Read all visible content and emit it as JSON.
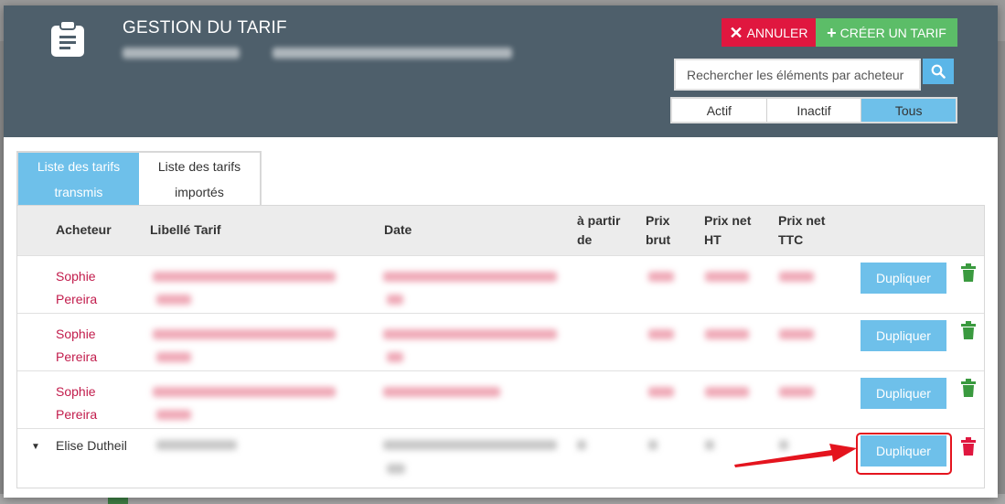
{
  "header": {
    "title": "GESTION DU TARIF",
    "cancel_label": "ANNULER",
    "create_label": "CRÉER UN TARIF",
    "search_placeholder": "Rechercher les éléments par acheteur",
    "filters": [
      {
        "label": "Actif",
        "active": false
      },
      {
        "label": "Inactif",
        "active": false
      },
      {
        "label": "Tous",
        "active": true
      }
    ]
  },
  "tabs": [
    {
      "label_line1": "Liste des tarifs",
      "label_line2": "transmis",
      "active": true
    },
    {
      "label_line1": "Liste des tarifs",
      "label_line2": "importés",
      "active": false
    }
  ],
  "table": {
    "columns": {
      "buyer": "Acheteur",
      "label": "Libellé Tarif",
      "date": "Date",
      "from_line1": "à partir",
      "from_line2": "de",
      "gross_line1": "Prix",
      "gross_line2": "brut",
      "net_ht_line1": "Prix net",
      "net_ht_line2": "HT",
      "net_ttc_line1": "Prix net",
      "net_ttc_line2": "TTC"
    },
    "rows": [
      {
        "buyer_first": "Sophie",
        "buyer_last": "Pereira",
        "action": "Dupliquer",
        "trash_color": "#3a9a3f"
      },
      {
        "buyer_first": "Sophie",
        "buyer_last": "Pereira",
        "action": "Dupliquer",
        "trash_color": "#3a9a3f"
      },
      {
        "buyer_first": "Sophie",
        "buyer_last": "Pereira",
        "action": "Dupliquer",
        "trash_color": "#3a9a3f"
      },
      {
        "buyer_first": "Elise Dutheil",
        "buyer_last": "",
        "action": "Dupliquer",
        "trash_color": "#e0173f"
      }
    ]
  },
  "colors": {
    "header_bg": "#4e5f6b",
    "accent_blue": "#6ec0ea",
    "cancel_red": "#e0173f",
    "create_green": "#5cbd68",
    "buyer_pink": "#c21c4c"
  },
  "icons": {
    "header": "clipboard-icon",
    "cancel": "close-icon",
    "create": "plus-icon",
    "search": "search-icon",
    "trash": "trash-icon",
    "expand": "caret-down-icon"
  }
}
